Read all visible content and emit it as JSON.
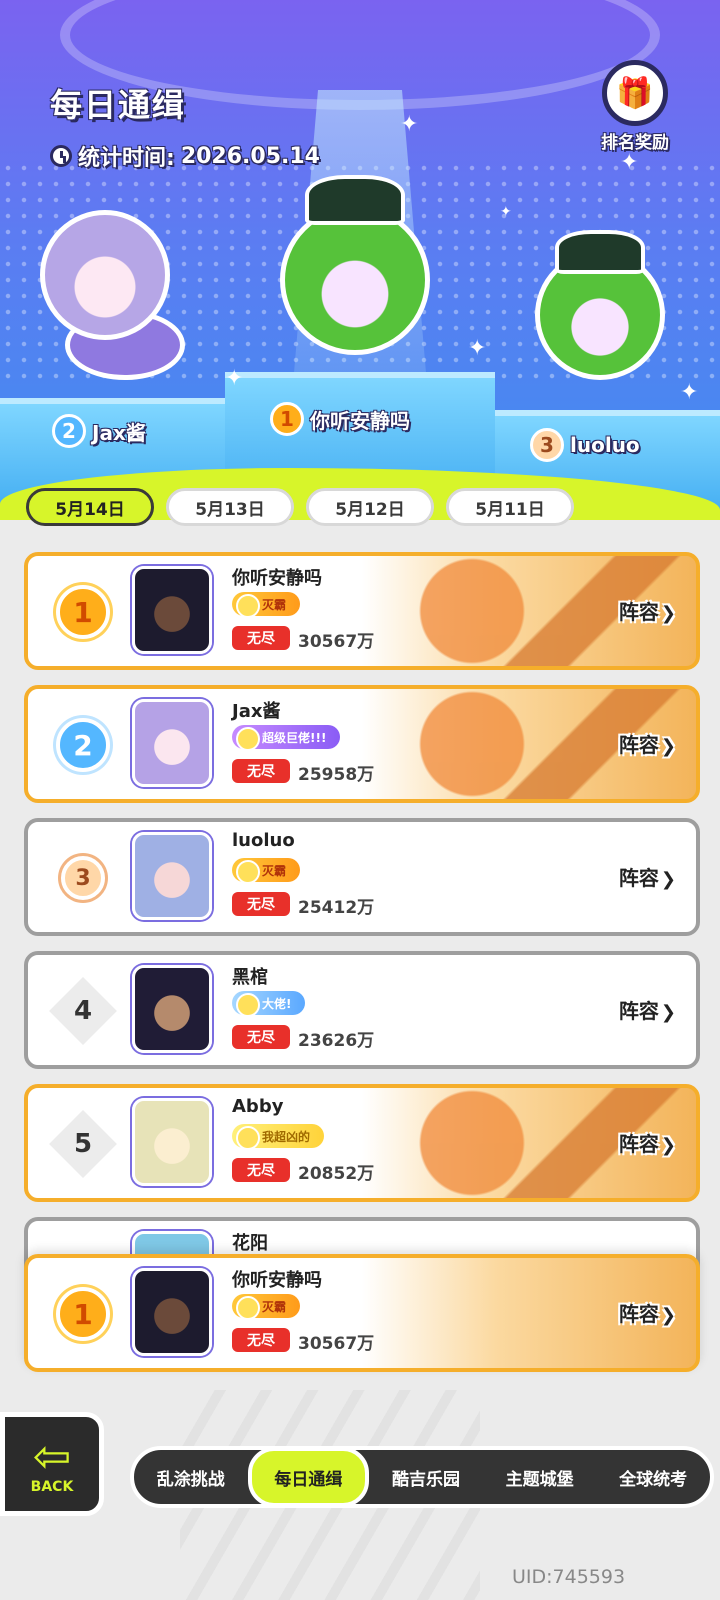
{
  "header": {
    "title": "每日通缉",
    "stat_label": "统计时间:",
    "stat_date": "2026.05.14",
    "reward_label": "排名奖励"
  },
  "podium": [
    {
      "rank": "1",
      "name": "你听安静吗"
    },
    {
      "rank": "2",
      "name": "Jax酱"
    },
    {
      "rank": "3",
      "name": "luoluo"
    }
  ],
  "date_tabs": [
    "5月14日",
    "5月13日",
    "5月12日",
    "5月11日"
  ],
  "mode_label": "无尽",
  "lineup_label": "阵容",
  "rankings": [
    {
      "rank": "1",
      "name": "你听安静吗",
      "title": "灭霸",
      "score": "30567万"
    },
    {
      "rank": "2",
      "name": "Jax酱",
      "title": "超级巨佬!!!",
      "score": "25958万"
    },
    {
      "rank": "3",
      "name": "luoluo",
      "title": "灭霸",
      "score": "25412万"
    },
    {
      "rank": "4",
      "name": "黑棺",
      "title": "大佬!",
      "score": "23626万"
    },
    {
      "rank": "5",
      "name": "Abby",
      "title": "我超凶的",
      "score": "20852万"
    },
    {
      "rank": "",
      "name": "花阳",
      "title": "",
      "score": ""
    }
  ],
  "my_rank": {
    "rank": "1",
    "name": "你听安静吗",
    "title": "灭霸",
    "score": "30567万"
  },
  "back_label": "BACK",
  "nav": [
    "乱涂挑战",
    "每日通缉",
    "酷吉乐园",
    "主题城堡",
    "全球统考"
  ],
  "uid": "UID:745593",
  "colors": {
    "accent": "#d7f52a",
    "gold_border": "#f5ae2b",
    "mode_red": "#e8302a",
    "nav_bg": "#343434"
  }
}
